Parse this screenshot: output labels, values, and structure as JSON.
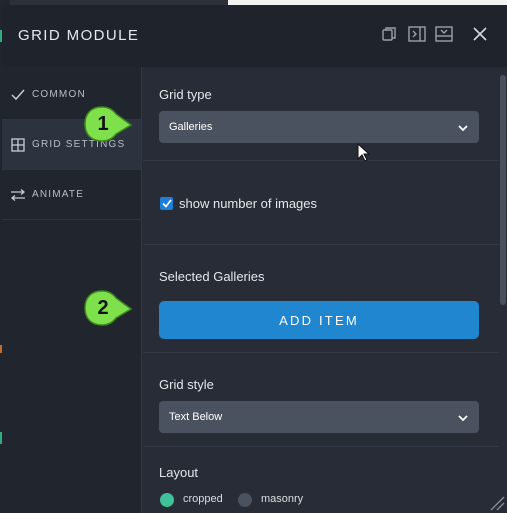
{
  "window": {
    "title": "GRID MODULE"
  },
  "header_icons": [
    "copy-icon",
    "sidebar-toggle-icon",
    "collapse-icon",
    "close-icon"
  ],
  "sidebar": {
    "items": [
      {
        "label": "COMMON",
        "icon": "check-icon",
        "active": false
      },
      {
        "label": "GRID SETTINGS",
        "icon": "grid-icon",
        "active": true
      },
      {
        "label": "ANIMATE",
        "icon": "swap-arrows-icon",
        "active": false
      }
    ]
  },
  "content": {
    "grid_type": {
      "label": "Grid type",
      "value": "Galleries"
    },
    "show_count": {
      "label": "show number of images",
      "checked": true
    },
    "selected_galleries": {
      "label": "Selected Galleries",
      "button": "ADD ITEM"
    },
    "grid_style": {
      "label": "Grid style",
      "value": "Text Below"
    },
    "layout": {
      "label": "Layout",
      "options": [
        {
          "label": "cropped",
          "selected": true
        },
        {
          "label": "masonry",
          "selected": false
        }
      ]
    }
  },
  "callouts": {
    "first": "1",
    "second": "2"
  },
  "colors": {
    "accent_button": "#1f86cf",
    "checkbox": "#1e7fd9",
    "radio_selected": "#3fc29a",
    "callout_green": "#7ee04a"
  }
}
